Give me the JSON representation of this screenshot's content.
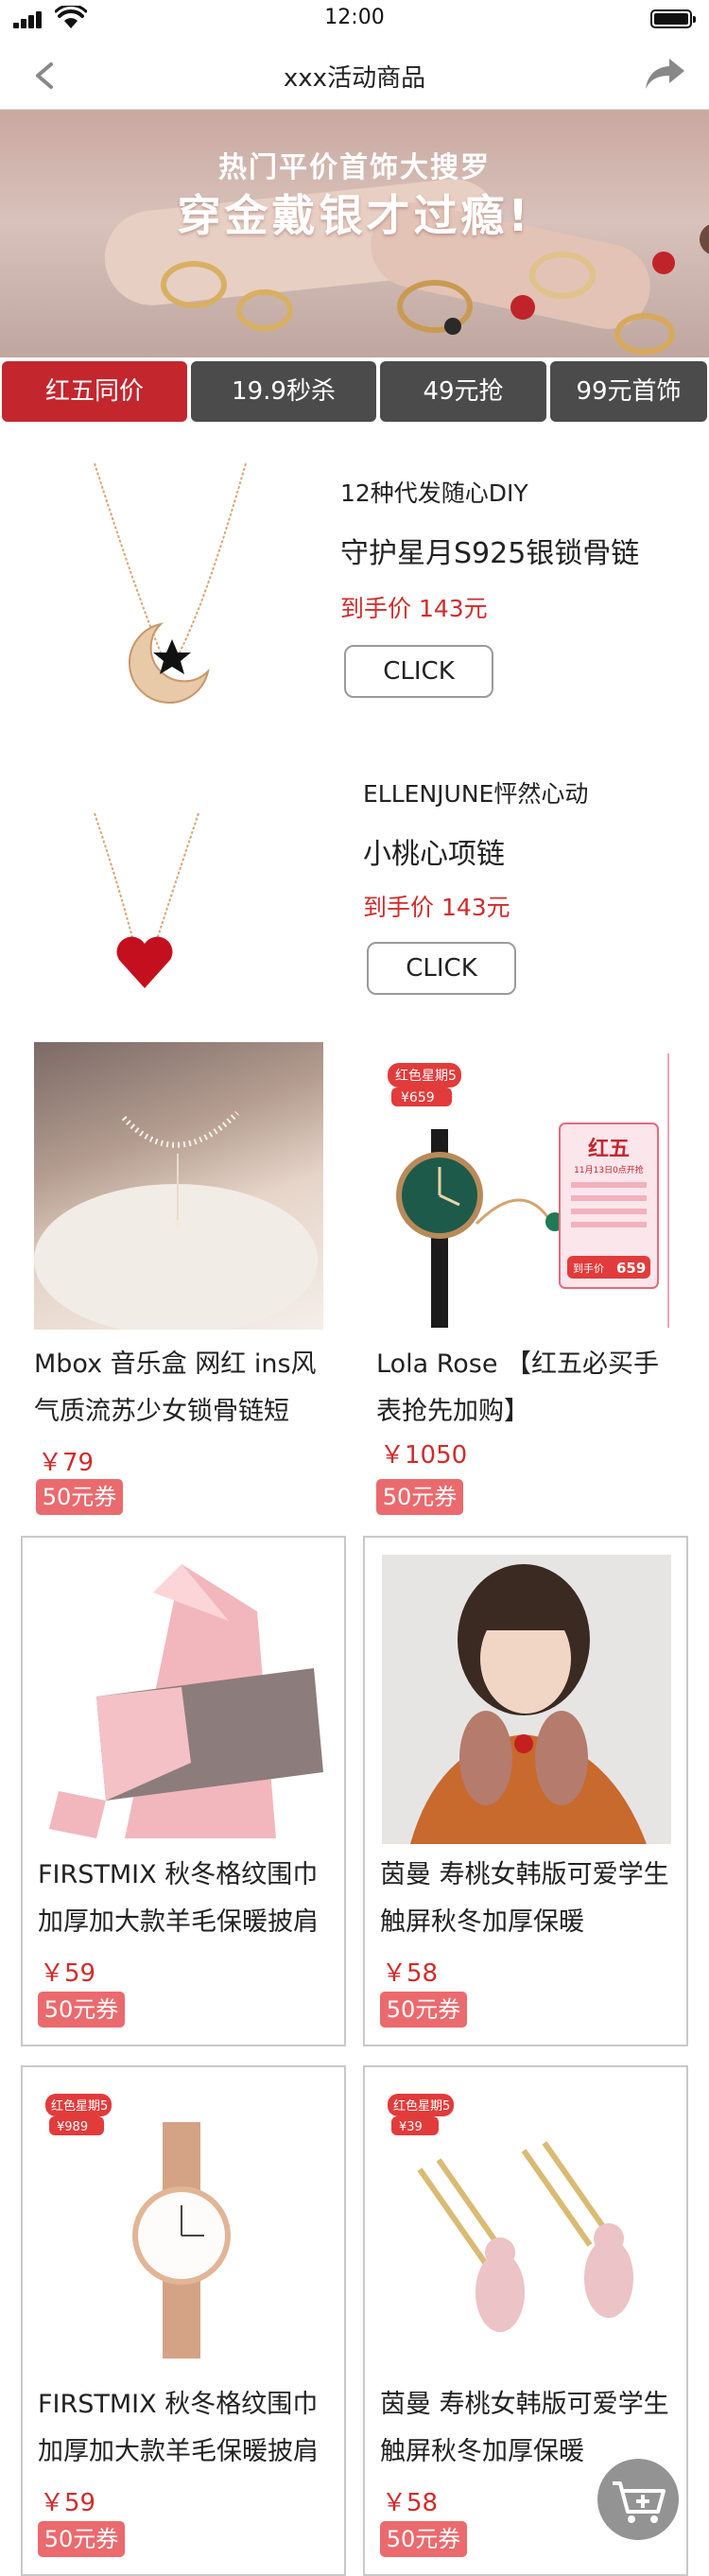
{
  "status_bar": {
    "time": "12:00"
  },
  "nav": {
    "title": "xxx活动商品"
  },
  "banner": {
    "line1": "热门平价首饰大搜罗",
    "line2": "穿金戴银才过瘾!"
  },
  "tabs": [
    {
      "label": "红五同价",
      "active": true
    },
    {
      "label": "19.9秒杀",
      "active": false
    },
    {
      "label": "49元抢",
      "active": false
    },
    {
      "label": "99元首饰",
      "active": false
    }
  ],
  "featured": [
    {
      "brand": "12种代发随心DIY",
      "name": "守护星月S925银锁骨链",
      "price": "到手价 143元",
      "button": "CLICK",
      "icon": "moon-necklace-image"
    },
    {
      "brand": "ELLENJUNE怦然心动",
      "name": "小桃心项链",
      "price": "到手价 143元",
      "button": "CLICK",
      "icon": "heart-necklace-image"
    }
  ],
  "products": [
    {
      "title_line1": "Mbox 音乐盒 网红 ins风",
      "title_line2": "气质流苏少女锁骨链短",
      "price": "￥79",
      "coupon": "50元券",
      "icon": "pearl-necklace-photo"
    },
    {
      "title_line1": "Lola Rose 【红五必买手",
      "title_line2": "表抢先加购】",
      "price": "￥1050",
      "coupon": "50元券",
      "icon": "green-watch-photo",
      "badge": {
        "top": "红色星期5",
        "price": "¥659",
        "panel_title": "红五",
        "panel_date": "11月13日0点开抢",
        "panel_price_label": "到手价",
        "panel_price": "659"
      }
    },
    {
      "title_line1": "FIRSTMIX 秋冬格纹围巾",
      "title_line2": "加厚加大款羊毛保暖披肩",
      "price": "￥59",
      "coupon": "50元券",
      "icon": "pink-scarf-photo"
    },
    {
      "title_line1": "茵曼 寿桃女韩版可爱学生",
      "title_line2": "触屏秋冬加厚保暖",
      "price": "￥58",
      "coupon": "50元券",
      "icon": "gloves-model-photo"
    },
    {
      "title_line1": "FIRSTMIX 秋冬格纹围巾",
      "title_line2": "加厚加大款羊毛保暖披肩",
      "price": "￥59",
      "coupon": "50元券",
      "icon": "rose-gold-watch-photo",
      "badge": {
        "top": "红色星期5",
        "price": "¥989"
      }
    },
    {
      "title_line1": "茵曼 寿桃女韩版可爱学生",
      "title_line2": "触屏秋冬加厚保暖",
      "price": "￥58",
      "coupon": "50元券",
      "icon": "bear-pin-earrings-photo",
      "badge": {
        "top": "红色星期5",
        "price": "¥39"
      }
    }
  ],
  "colors": {
    "accent": "#c4262e",
    "price": "#d22b2b",
    "coupon": "#ea6a6e",
    "tab_inactive": "#4b4b4b"
  }
}
